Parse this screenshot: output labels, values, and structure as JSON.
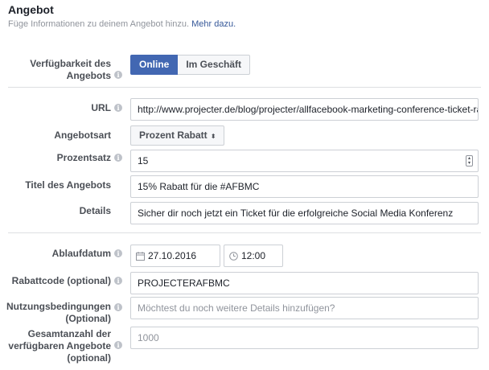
{
  "header": {
    "title": "Angebot",
    "subtitle": "Füge Informationen zu deinem Angebot hinzu.",
    "more_link": "Mehr dazu."
  },
  "availability": {
    "label_line1": "Verfügbarkeit des",
    "label_line2": "Angebots",
    "options": [
      "Online",
      "Im Geschäft"
    ],
    "selected": "Online"
  },
  "url": {
    "label": "URL",
    "value": "http://www.projecter.de/blog/projecter/allfacebook-marketing-conference-ticket-rabatt.htr"
  },
  "offer_type": {
    "label": "Angebotsart",
    "value": "Prozent Rabatt",
    "caret": "⬍"
  },
  "percent": {
    "label": "Prozentsatz",
    "value": "15"
  },
  "offer_title": {
    "label": "Titel des Angebots",
    "value": "15% Rabatt für die #AFBMC"
  },
  "details": {
    "label": "Details",
    "value": "Sicher dir noch jetzt ein Ticket für die erfolgreiche Social Media Konferenz"
  },
  "expiry": {
    "label": "Ablaufdatum",
    "date": "27.10.2016",
    "time": "12:00"
  },
  "coupon": {
    "label": "Rabattcode (optional)",
    "value": "PROJECTERAFBMC"
  },
  "terms": {
    "label_line1": "Nutzungsbedingungen",
    "label_line2": "(Optional)",
    "placeholder": "Möchtest du noch weitere Details hinzufügen?"
  },
  "total": {
    "label_line1": "Gesamtanzahl der",
    "label_line2": "verfügbaren Angebote",
    "label_line3": "(optional)",
    "placeholder": "1000"
  },
  "colors": {
    "accent": "#4267b2",
    "link": "#365899",
    "border": "#ccd0d5",
    "label": "#4b4f56",
    "muted": "#90949c"
  },
  "icons": {
    "info": "info-icon",
    "calendar": "calendar-icon",
    "clock": "clock-icon"
  }
}
